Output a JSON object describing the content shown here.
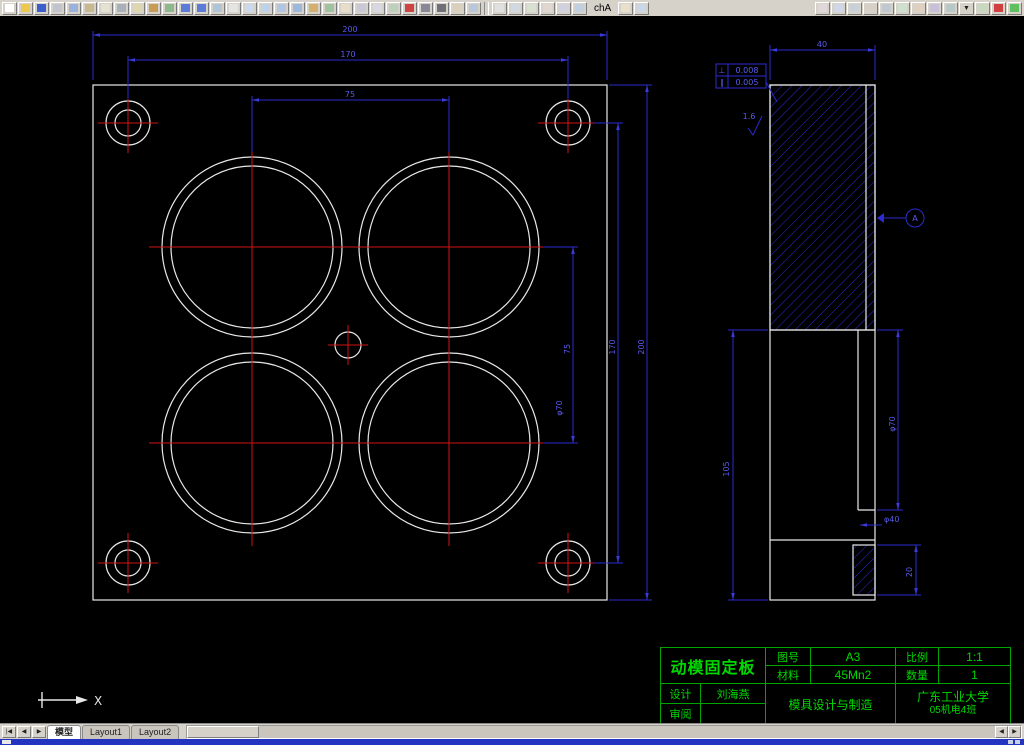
{
  "toolbar": {
    "style_name": "chA",
    "dropdown_glyph": "▼",
    "group1": [
      {
        "name": "new-icon",
        "color": "#ffffff",
        "glyph": ""
      },
      {
        "name": "open-icon",
        "color": "#eec84e",
        "glyph": ""
      },
      {
        "name": "save-icon",
        "color": "#3a5ecc",
        "glyph": ""
      },
      {
        "name": "plot-icon",
        "color": "#c0c4cc",
        "glyph": ""
      },
      {
        "name": "plot-preview-icon",
        "color": "#9ab2dc",
        "glyph": ""
      },
      {
        "name": "publish-icon",
        "color": "#c8b890",
        "glyph": ""
      },
      {
        "name": "spell-icon",
        "color": "#e6e2d2",
        "glyph": ""
      },
      {
        "name": "cut-icon",
        "color": "#a8b0bc",
        "glyph": ""
      },
      {
        "name": "copy-icon",
        "color": "#ded6ac",
        "glyph": ""
      },
      {
        "name": "paste-icon",
        "color": "#c89c54",
        "glyph": ""
      },
      {
        "name": "match-properties-icon",
        "color": "#8cb88c",
        "glyph": ""
      },
      {
        "name": "undo-icon",
        "color": "#5c7cd8",
        "glyph": ""
      },
      {
        "name": "redo-icon",
        "color": "#5c7cd8",
        "glyph": ""
      },
      {
        "name": "hyperlink-icon",
        "color": "#b0c4d8",
        "glyph": ""
      },
      {
        "name": "pan-icon",
        "color": "#e4e4e4",
        "glyph": ""
      },
      {
        "name": "zoom-realtime-icon",
        "color": "#ccd8ec",
        "glyph": ""
      },
      {
        "name": "zoom-window-icon",
        "color": "#bed2ec",
        "glyph": ""
      },
      {
        "name": "zoom-previous-icon",
        "color": "#b2c6e4",
        "glyph": ""
      },
      {
        "name": "properties-icon",
        "color": "#9cb8dc",
        "glyph": ""
      },
      {
        "name": "design-center-icon",
        "color": "#d4b06e",
        "glyph": ""
      },
      {
        "name": "tool-palettes-icon",
        "color": "#a0c2a0",
        "glyph": ""
      },
      {
        "name": "help-icon",
        "color": "#e6dec6",
        "glyph": ""
      },
      {
        "name": "layers-icon",
        "color": "#c8c8d8",
        "glyph": ""
      },
      {
        "name": "layer-control-icon",
        "color": "#d8d8e4",
        "glyph": ""
      },
      {
        "name": "make-layer-icon",
        "color": "#bcd0bc",
        "glyph": ""
      },
      {
        "name": "color-control-icon",
        "color": "#cc4444",
        "glyph": ""
      },
      {
        "name": "linetype-icon",
        "color": "#888898",
        "glyph": ""
      },
      {
        "name": "lineweight-icon",
        "color": "#707078",
        "glyph": ""
      },
      {
        "name": "text-style-icon",
        "color": "#d8d0b8",
        "glyph": ""
      },
      {
        "name": "dim-style-icon",
        "color": "#b8c8d8",
        "glyph": ""
      }
    ],
    "group2": [
      {
        "name": "line-tool-icon",
        "color": "#e0e0e0",
        "glyph": ""
      },
      {
        "name": "polyline-tool-icon",
        "color": "#d0d8e0",
        "glyph": ""
      },
      {
        "name": "circle-tool-icon",
        "color": "#d8e0d0",
        "glyph": ""
      },
      {
        "name": "arc-tool-icon",
        "color": "#e0d8d0",
        "glyph": ""
      },
      {
        "name": "rectangle-tool-icon",
        "color": "#d0d0e0",
        "glyph": ""
      },
      {
        "name": "hatch-tool-icon",
        "color": "#c0d0e0",
        "glyph": ""
      }
    ],
    "group3": [
      {
        "name": "text-tool-icon",
        "color": "#e8e0c8",
        "glyph": ""
      },
      {
        "name": "dimension-tool-icon",
        "color": "#c8d8e8",
        "glyph": ""
      }
    ],
    "group4": [
      {
        "name": "erase-icon",
        "color": "#e0d8d8",
        "glyph": ""
      },
      {
        "name": "copy-object-icon",
        "color": "#d0d8e8",
        "glyph": ""
      },
      {
        "name": "mirror-icon",
        "color": "#c8d0d8",
        "glyph": ""
      },
      {
        "name": "offset-icon",
        "color": "#d8d0c8",
        "glyph": ""
      },
      {
        "name": "array-icon",
        "color": "#c0c8d0",
        "glyph": ""
      },
      {
        "name": "move-icon",
        "color": "#d0e0d0",
        "glyph": ""
      },
      {
        "name": "rotate-icon",
        "color": "#e0d0c0",
        "glyph": ""
      },
      {
        "name": "scale-icon",
        "color": "#c8c0d8",
        "glyph": ""
      },
      {
        "name": "trim-icon",
        "color": "#b8c8c8",
        "glyph": ""
      },
      {
        "name": "dropdown-arrow-icon",
        "color": "",
        "glyph": "▼"
      },
      {
        "name": "extend-icon",
        "color": "#c8d8c0",
        "glyph": ""
      }
    ],
    "group5": [
      {
        "name": "object-color-icon",
        "color": "#d04040",
        "glyph": ""
      },
      {
        "name": "layer-state-icon",
        "color": "#60c060",
        "glyph": ""
      }
    ]
  },
  "tab_nav": [
    {
      "name": "tab-first-button",
      "label": "|◀"
    },
    {
      "name": "tab-prev-button",
      "label": "◀"
    },
    {
      "name": "tab-next-button",
      "label": "▶"
    }
  ],
  "tabs": {
    "model": "模型",
    "layout1": "Layout1",
    "layout2": "Layout2"
  },
  "scrollbar": {
    "left_arrow": "◀",
    "right_arrow": "▶"
  },
  "ucs": {
    "x_label": "X"
  },
  "dims": {
    "front": {
      "width": "200",
      "hole_spacing_h": "170",
      "cavity_spacing_h": "75",
      "height": "200",
      "hole_spacing_v": "170",
      "cavity_spacing_v": "75",
      "cavity_dia": "φ70"
    },
    "side": {
      "thickness": "40",
      "bore_dia": "φ70",
      "boss_height": "20",
      "lower_height": "105",
      "step_dia": "φ40"
    },
    "gdt": {
      "perpendicularity_symbol": "⊥",
      "perpendicularity": "0.008",
      "parallelism_symbol": "∥",
      "parallelism": "0.005",
      "surface_finish": "1.6",
      "datum": "A"
    }
  },
  "title_block": {
    "part_name": "动模固定板",
    "drawing_no_label": "图号",
    "drawing_no": "A3",
    "scale_label": "比例",
    "scale": "1:1",
    "material_label": "材料",
    "material": "45Mn2",
    "quantity_label": "数量",
    "quantity": "1",
    "designer_label": "设计",
    "designer": "刘海燕",
    "reviewer_label": "审阅",
    "reviewer": "",
    "course": "模具设计与制造",
    "school": "广东工业大学",
    "class_name": "05机电4班"
  }
}
